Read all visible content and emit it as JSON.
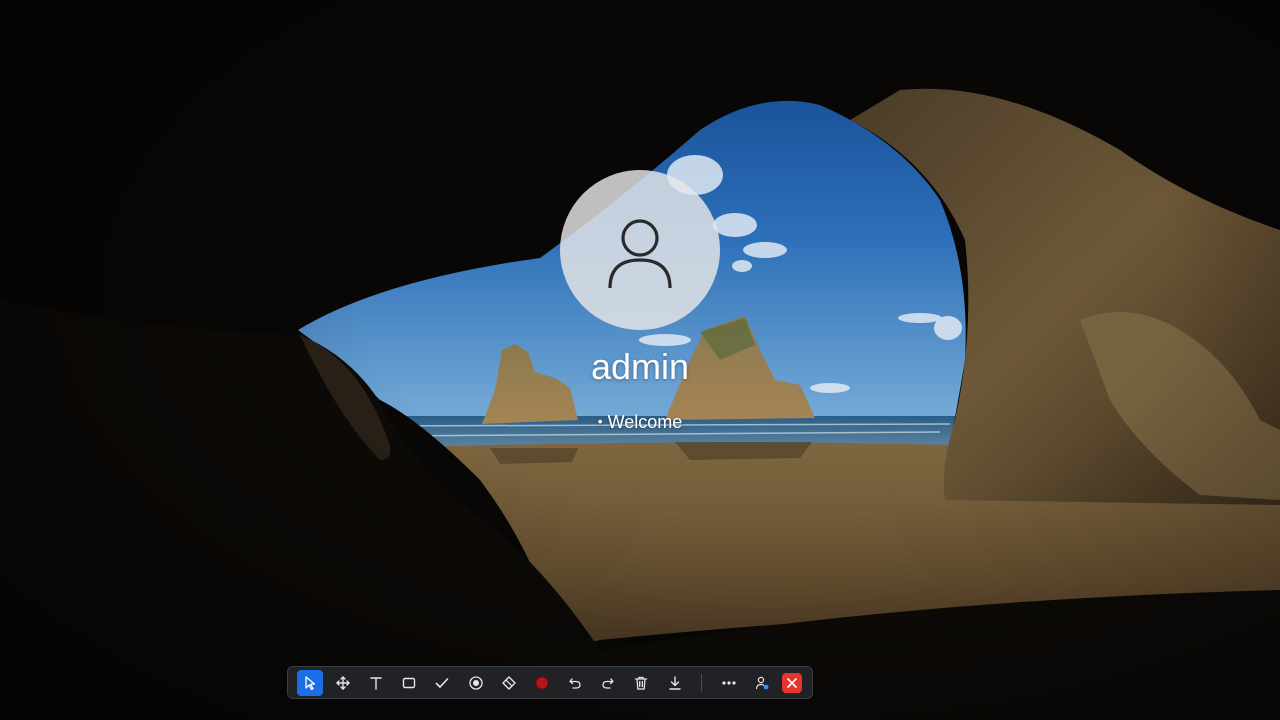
{
  "login": {
    "username": "admin",
    "status_text": "Welcome",
    "status_bullet": "•"
  },
  "toolbar": {
    "tools": [
      {
        "icon": "cursor-arrow-icon",
        "active": true
      },
      {
        "icon": "move-arrows-icon"
      },
      {
        "icon": "text-tool-icon"
      },
      {
        "icon": "rectangle-icon"
      },
      {
        "icon": "checkmark-icon"
      },
      {
        "icon": "target-circle-icon"
      },
      {
        "icon": "eraser-icon"
      },
      {
        "icon": "record-circle-icon"
      },
      {
        "icon": "undo-icon"
      },
      {
        "icon": "redo-icon"
      },
      {
        "icon": "trash-icon"
      },
      {
        "icon": "download-icon"
      },
      {
        "icon": "more-options-icon"
      },
      {
        "icon": "user-settings-icon"
      },
      {
        "icon": "close-icon"
      }
    ],
    "accent_color": "#1a6fe6",
    "close_color": "#e5352d",
    "record_color": "#b3161c"
  }
}
